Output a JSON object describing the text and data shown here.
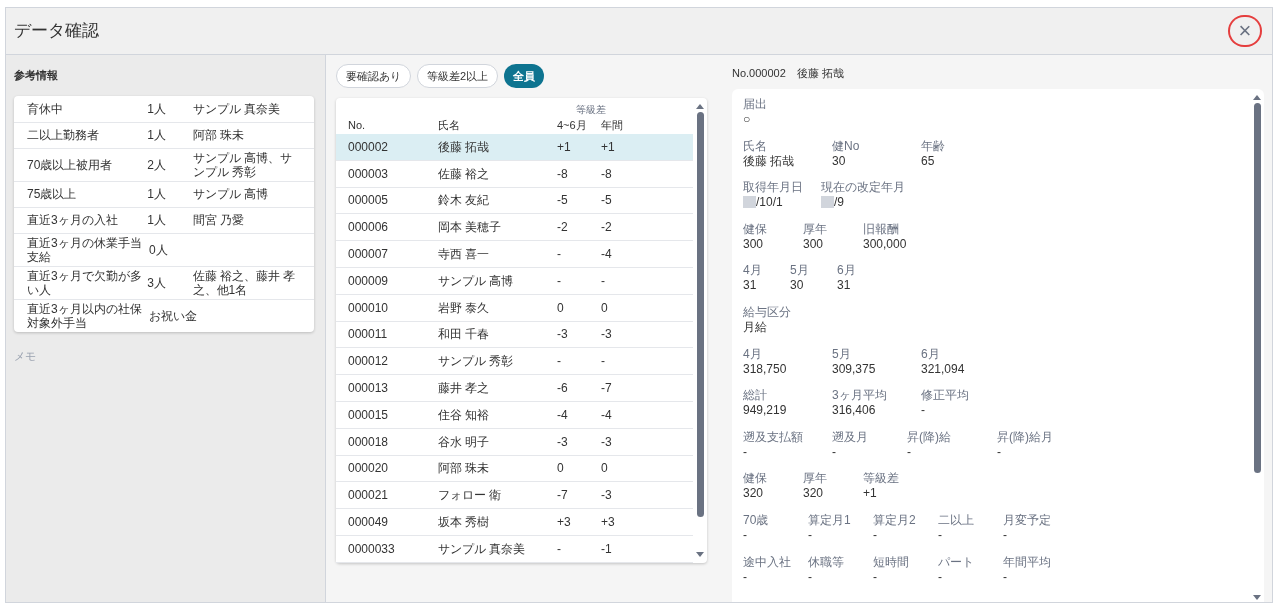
{
  "window": {
    "title": "データ確認",
    "close": {
      "label": "×",
      "highlighted": true
    }
  },
  "reference": {
    "title": "参考情報",
    "rows": [
      {
        "item": "育休中",
        "count": "1人",
        "names": "サンプル 真奈美"
      },
      {
        "item": "二以上勤務者",
        "count": "1人",
        "names": "阿部 珠未"
      },
      {
        "item": "70歳以上被用者",
        "count": "2人",
        "names": "サンプル 高博、サンプル 秀彰"
      },
      {
        "item": "75歳以上",
        "count": "1人",
        "names": "サンプル 高博"
      },
      {
        "item": "直近3ヶ月の入社",
        "count": "1人",
        "names": "間宮 乃愛"
      },
      {
        "item": "直近3ヶ月の休業手当支給",
        "count": "0人"
      },
      {
        "item": "直近3ヶ月で欠勤が多い人",
        "count": "3人",
        "names": "佐藤 裕之、藤井 孝之、他1名"
      },
      {
        "item": "直近3ヶ月以内の社保対象外手当",
        "count": "お祝い金"
      }
    ],
    "memo_label": "メモ"
  },
  "filters": [
    {
      "label": "要確認あり",
      "selected": false
    },
    {
      "label": "等級差2以上",
      "selected": false
    },
    {
      "label": "全員",
      "selected": true
    }
  ],
  "table": {
    "group_header": "等級差",
    "columns": [
      "No.",
      "氏名",
      "4~6月",
      "年間"
    ],
    "rows": [
      {
        "no": "000002",
        "name": "後藤 拓哉",
        "q": "+1",
        "year": "+1",
        "selected": true
      },
      {
        "no": "000003",
        "name": "佐藤 裕之",
        "q": "-8",
        "year": "-8",
        "selected": false
      },
      {
        "no": "000005",
        "name": "鈴木 友紀",
        "q": "-5",
        "year": "-5",
        "selected": false
      },
      {
        "no": "000006",
        "name": "岡本 美穂子",
        "q": "-2",
        "year": "-2",
        "selected": false
      },
      {
        "no": "000007",
        "name": "寺西 喜一",
        "q": "-",
        "year": "-4",
        "selected": false
      },
      {
        "no": "000009",
        "name": "サンプル 高博",
        "q": "-",
        "year": "-",
        "selected": false
      },
      {
        "no": "000010",
        "name": "岩野 泰久",
        "q": "0",
        "year": "0",
        "selected": false
      },
      {
        "no": "000011",
        "name": "和田 千春",
        "q": "-3",
        "year": "-3",
        "selected": false
      },
      {
        "no": "000012",
        "name": "サンプル 秀彰",
        "q": "-",
        "year": "-",
        "selected": false
      },
      {
        "no": "000013",
        "name": "藤井 孝之",
        "q": "-6",
        "year": "-7",
        "selected": false
      },
      {
        "no": "000015",
        "name": "住谷 知裕",
        "q": "-4",
        "year": "-4",
        "selected": false
      },
      {
        "no": "000018",
        "name": "谷水 明子",
        "q": "-3",
        "year": "-3",
        "selected": false
      },
      {
        "no": "000020",
        "name": "阿部 珠未",
        "q": "0",
        "year": "0",
        "selected": false
      },
      {
        "no": "000021",
        "name": "フォロー 衛",
        "q": "-7",
        "year": "-3",
        "selected": false
      },
      {
        "no": "000049",
        "name": "坂本 秀樹",
        "q": "+3",
        "year": "+3",
        "selected": false
      },
      {
        "no": "0000033",
        "name": "サンプル 真奈美",
        "q": "-",
        "year": "-1",
        "selected": false
      }
    ]
  },
  "detail": {
    "title": "No.000002　後藤 拓哉",
    "rows": [
      {
        "fields": [
          {
            "label": "届出",
            "value": "○"
          }
        ]
      },
      {
        "fields": [
          {
            "label": "氏名",
            "value": "後藤 拓哉"
          },
          {
            "label": "健No",
            "value": "30"
          },
          {
            "label": "年齢",
            "value": "65"
          }
        ]
      },
      {
        "fields": [
          {
            "label": "取得年月日",
            "value": "/10/1",
            "redacted": true
          },
          {
            "label": "現在の改定年月",
            "value": "/9",
            "redacted": true
          }
        ]
      },
      {
        "fields": [
          {
            "label": "健保",
            "value": "300"
          },
          {
            "label": "厚年",
            "value": "300"
          },
          {
            "label": "旧報酬",
            "value": "300,000"
          }
        ]
      },
      {
        "fields": [
          {
            "label": "4月",
            "value": "31"
          },
          {
            "label": "5月",
            "value": "30"
          },
          {
            "label": "6月",
            "value": "31"
          }
        ]
      },
      {
        "fields": [
          {
            "label": "給与区分",
            "value": "月給"
          }
        ]
      },
      {
        "fields": [
          {
            "label": "4月",
            "value": "318,750"
          },
          {
            "label": "5月",
            "value": "309,375"
          },
          {
            "label": "6月",
            "value": "321,094"
          }
        ]
      },
      {
        "fields": [
          {
            "label": "総計",
            "value": "949,219"
          },
          {
            "label": "3ヶ月平均",
            "value": "316,406"
          },
          {
            "label": "修正平均",
            "value": "-"
          }
        ]
      },
      {
        "fields": [
          {
            "label": "遡及支払額",
            "value": "-"
          },
          {
            "label": "遡及月",
            "value": "-"
          },
          {
            "label": "昇(降)給",
            "value": "-"
          },
          {
            "label": "昇(降)給月",
            "value": "-"
          }
        ]
      },
      {
        "fields": [
          {
            "label": "健保",
            "value": "320"
          },
          {
            "label": "厚年",
            "value": "320"
          },
          {
            "label": "等級差",
            "value": "+1"
          }
        ]
      },
      {
        "fields": [
          {
            "label": "70歳",
            "value": "-"
          },
          {
            "label": "算定月1",
            "value": "-"
          },
          {
            "label": "算定月2",
            "value": "-"
          },
          {
            "label": "二以上",
            "value": "-"
          },
          {
            "label": "月変予定",
            "value": "-"
          }
        ]
      },
      {
        "fields": [
          {
            "label": "途中入社",
            "value": "-"
          },
          {
            "label": "休職等",
            "value": "-"
          },
          {
            "label": "短時間",
            "value": "-"
          },
          {
            "label": "パート",
            "value": "-"
          },
          {
            "label": "年間平均",
            "value": "-"
          }
        ]
      }
    ]
  }
}
